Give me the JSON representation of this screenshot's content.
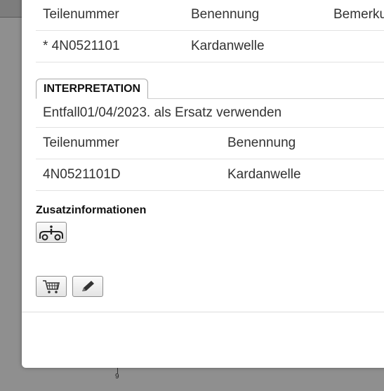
{
  "background": {
    "axis_tick_label": "9"
  },
  "table_top": {
    "headers": [
      "Teilenummer",
      "Benennung",
      "Bemerku"
    ],
    "rows": [
      [
        "* 4N0521101",
        "Kardanwelle",
        ""
      ]
    ]
  },
  "interpretation": {
    "tab_label": "INTERPRETATION",
    "text": "Entfall01/04/2023. als Ersatz verwenden"
  },
  "table_bottom": {
    "headers": [
      "Teilenummer",
      "Benennung"
    ],
    "rows": [
      [
        "4N0521101D",
        "Kardanwelle"
      ]
    ]
  },
  "zusatz": {
    "label": "Zusatzinformationen",
    "info_icon": "vehicle-info-icon"
  },
  "actions": {
    "cart_icon": "cart-icon",
    "edit_icon": "pencil-icon"
  }
}
